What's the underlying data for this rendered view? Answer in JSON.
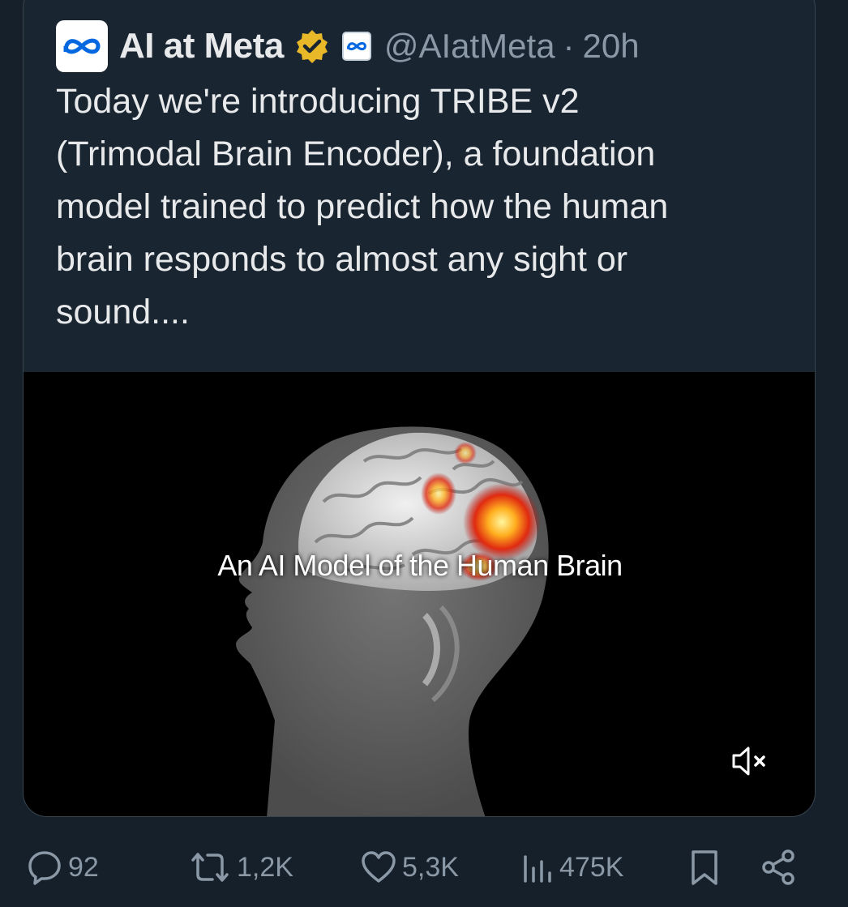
{
  "tweet": {
    "author_name": "AI at Meta",
    "handle": "@AIatMeta",
    "separator": "·",
    "time": "20h",
    "text": "Today we're introducing TRIBE v2\n(Trimodal Brain Encoder), a foundation\nmodel trained to predict how the human\nbrain responds to almost any sight or\nsound...."
  },
  "media": {
    "caption": "An AI Model of the Human Brain",
    "muted": true
  },
  "actions": {
    "replies": "92",
    "reposts": "1,2K",
    "likes": "5,3K",
    "views": "475K"
  },
  "colors": {
    "background": "#15202b",
    "card": "#1a2532",
    "muted_text": "#8b98a5",
    "verified_gold": "#e8b829",
    "meta_blue": "#0668e1"
  },
  "icons": {
    "avatar": "meta-logo-icon",
    "verified": "verified-gold-badge-icon",
    "affiliation": "meta-affiliation-icon",
    "mute": "volume-muted-icon",
    "reply": "reply-bubble-icon",
    "repost": "repost-icon",
    "like": "heart-icon",
    "views": "views-bars-icon",
    "bookmark": "bookmark-icon",
    "share": "share-icon"
  }
}
